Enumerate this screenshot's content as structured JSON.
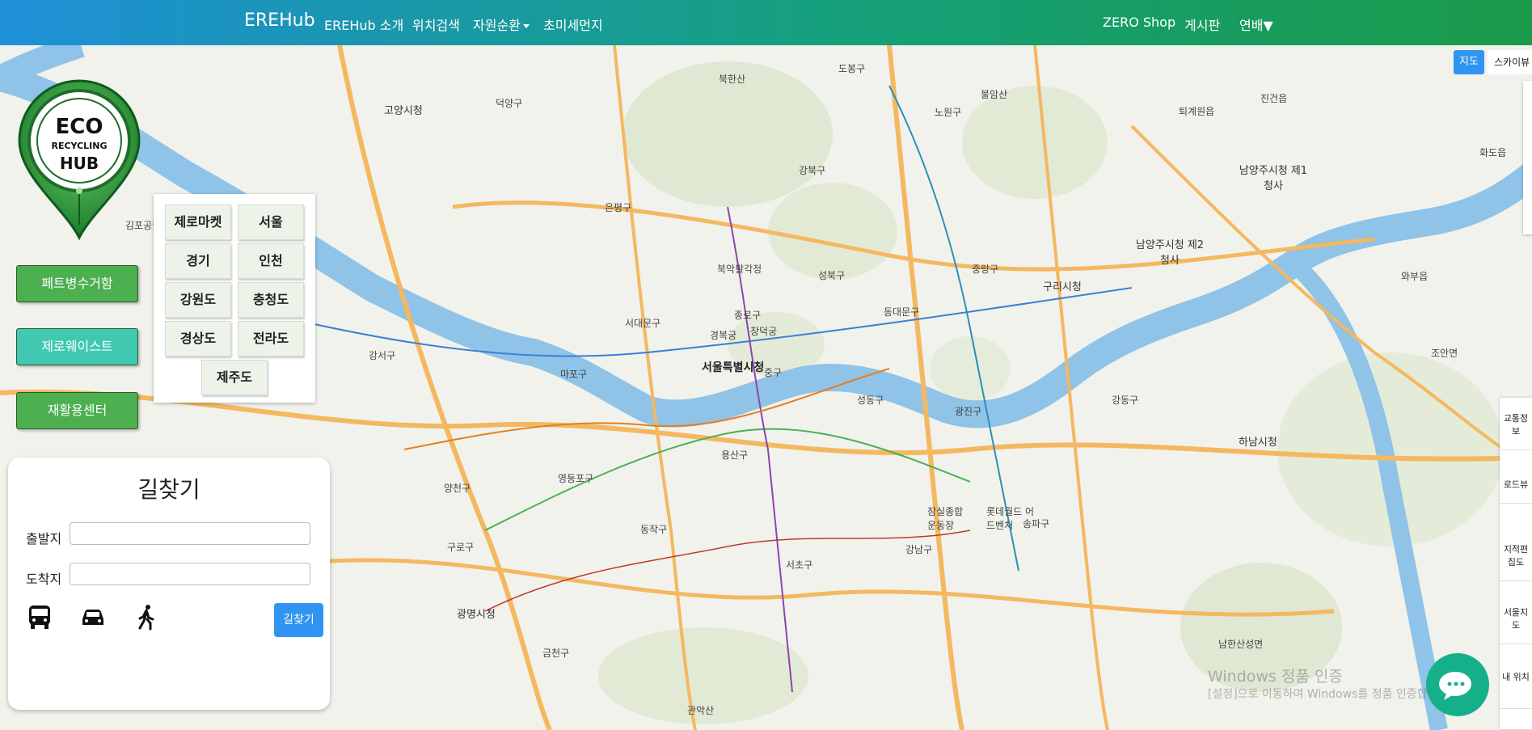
{
  "navbar": {
    "brand": "EREHub",
    "links": [
      "EREHub 소개",
      "위치검색",
      "자원순환",
      "초미세먼지"
    ],
    "right_links": [
      "ZERO Shop",
      "게시판",
      "연배▼"
    ]
  },
  "logo": {
    "line1": "ECO",
    "line2": "RECYCLING",
    "line3": "HUB"
  },
  "side_buttons": [
    "페트병수거함",
    "제로웨이스트",
    "재활용센터"
  ],
  "regions": [
    "제로마켓",
    "서울",
    "경기",
    "인천",
    "강원도",
    "충청도",
    "경상도",
    "전라도",
    "제주도"
  ],
  "route": {
    "title": "길찾기",
    "origin_label": "출발지",
    "destination_label": "도착지",
    "origin_value": "",
    "destination_value": "",
    "search_button": "길찾기",
    "modes": [
      "bus-icon",
      "car-icon",
      "walk-icon"
    ]
  },
  "map": {
    "type_selected": "지도",
    "type_other": "스카이뷰",
    "labels": [
      {
        "text": "서울특별시청",
        "cls": "big"
      },
      {
        "text": "고양시청",
        "cls": "city"
      },
      {
        "text": "구리시청",
        "cls": "city"
      },
      {
        "text": "하남시청",
        "cls": "city"
      },
      {
        "text": "광명시청",
        "cls": "city"
      },
      {
        "text": "남양주시청 제2청사",
        "cls": "city"
      },
      {
        "text": "남양주시청 제1청사",
        "cls": "city"
      },
      {
        "text": "덕양구"
      },
      {
        "text": "도봉구"
      },
      {
        "text": "노원구"
      },
      {
        "text": "강북구"
      },
      {
        "text": "은평구"
      },
      {
        "text": "성북구"
      },
      {
        "text": "중랑구"
      },
      {
        "text": "동대문구"
      },
      {
        "text": "서대문구"
      },
      {
        "text": "종로구"
      },
      {
        "text": "중구"
      },
      {
        "text": "마포구"
      },
      {
        "text": "용산구"
      },
      {
        "text": "성동구"
      },
      {
        "text": "광진구"
      },
      {
        "text": "강동구"
      },
      {
        "text": "영등포구"
      },
      {
        "text": "동작구"
      },
      {
        "text": "서초구"
      },
      {
        "text": "강남구"
      },
      {
        "text": "송파구"
      },
      {
        "text": "양천구"
      },
      {
        "text": "강서구"
      },
      {
        "text": "구로구"
      },
      {
        "text": "금천구"
      },
      {
        "text": "관악산"
      },
      {
        "text": "북한산"
      },
      {
        "text": "불암산"
      },
      {
        "text": "진건읍"
      },
      {
        "text": "퇴계원읍"
      },
      {
        "text": "화도읍"
      },
      {
        "text": "와부읍"
      },
      {
        "text": "조안면"
      },
      {
        "text": "남한산성면"
      },
      {
        "text": "북악팔각정"
      },
      {
        "text": "김포공항"
      },
      {
        "text": "잠실종합운동장"
      },
      {
        "text": "롯데월드 어드벤처"
      },
      {
        "text": "경복궁"
      },
      {
        "text": "창덕궁"
      }
    ],
    "tools": [
      "교통정보",
      "로드뷰",
      "지적편집도",
      "서울지도",
      "내 위치"
    ]
  },
  "watermark": {
    "line1": "Windows 정품 인증",
    "line2": "[설정]으로 이동하여 Windows를 정품 인증합니다."
  },
  "colors": {
    "navbar_start": "#1e90d8",
    "navbar_end": "#1a9a4a",
    "green_button": "#4caf50",
    "teal_button": "#40c8b0",
    "primary_blue": "#2f95f0",
    "river": "#8fc3e8"
  }
}
